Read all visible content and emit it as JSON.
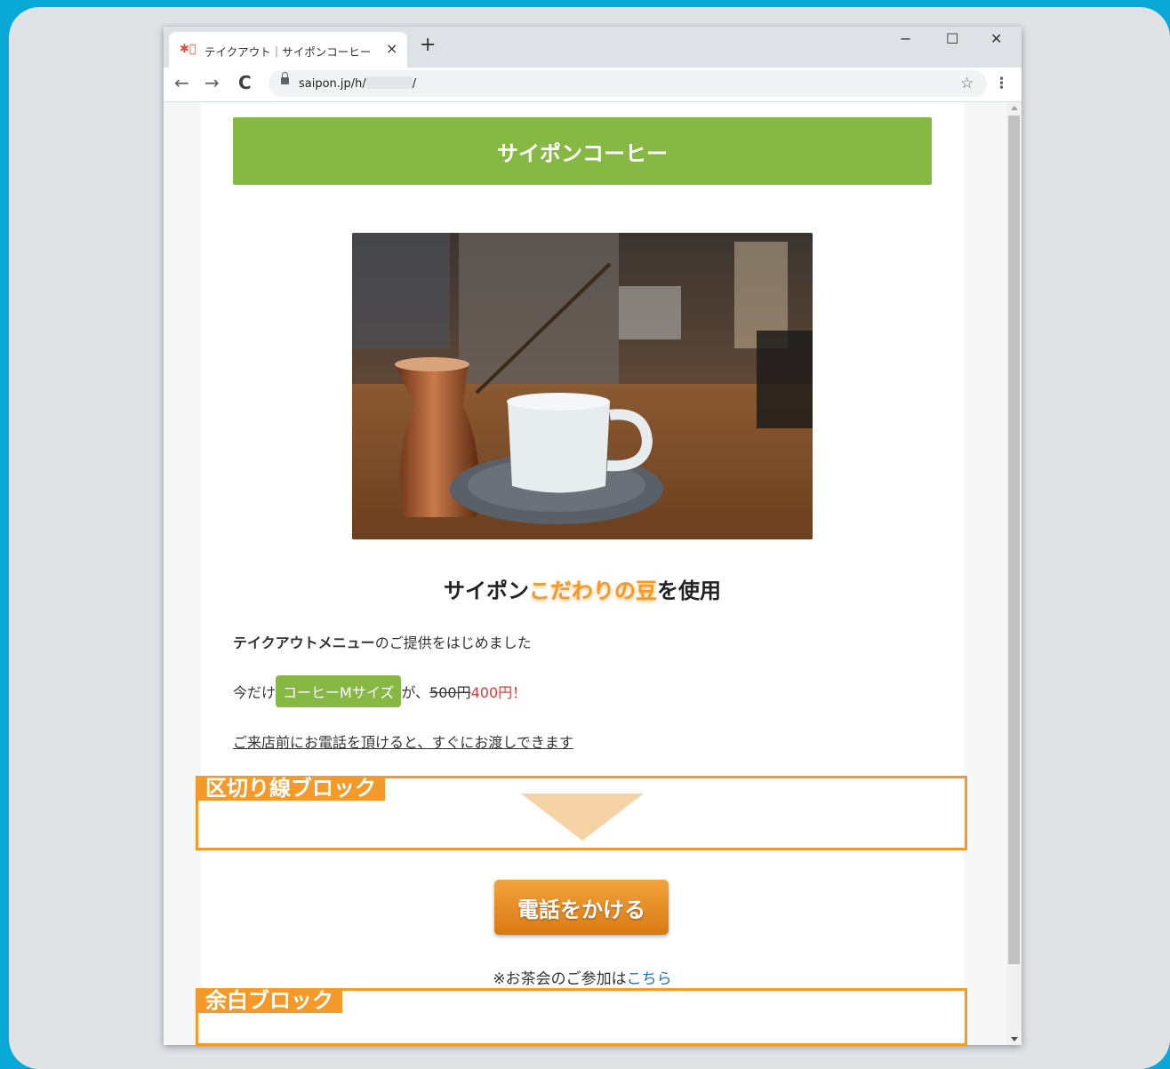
{
  "browser": {
    "tab_title": "テイクアウト｜サイポンコーヒー",
    "tab_close": "×",
    "new_tab": "+",
    "window_controls": {
      "minimize": "−",
      "maximize": "☐",
      "close": "✕"
    },
    "nav": {
      "back": "←",
      "forward": "→",
      "reload": "C"
    },
    "url_prefix": "saipon.jp/h/",
    "url_suffix": "/",
    "star": "☆",
    "menu": "⋮"
  },
  "page": {
    "header_title": "サイポンコーヒー",
    "headline": {
      "before": "サイポン",
      "accent": "こだわりの豆",
      "after": "を使用"
    },
    "line1": {
      "bold": "テイクアウトメニュー",
      "rest": "のご提供をはじめました"
    },
    "line2": {
      "prefix": "今だけ",
      "badge": "コーヒーMサイズ",
      "middle": "が、",
      "old_price": "500円",
      "new_price": "400円！"
    },
    "line3": "ご来店前にお電話を頂けると、すぐにお渡しできます",
    "call_button": "電話をかける",
    "note": {
      "text": "※お茶会のご参加は",
      "link": "こちら"
    }
  },
  "annotations": {
    "divider_block": "区切り線ブロック",
    "spacer_block": "余白ブロック"
  },
  "colors": {
    "banner": "#86b843",
    "accent": "#f39a2a",
    "arrow": "#f6d3a6",
    "button": "#e38a20",
    "price_red": "#e53935",
    "link": "#2a6fb5"
  }
}
